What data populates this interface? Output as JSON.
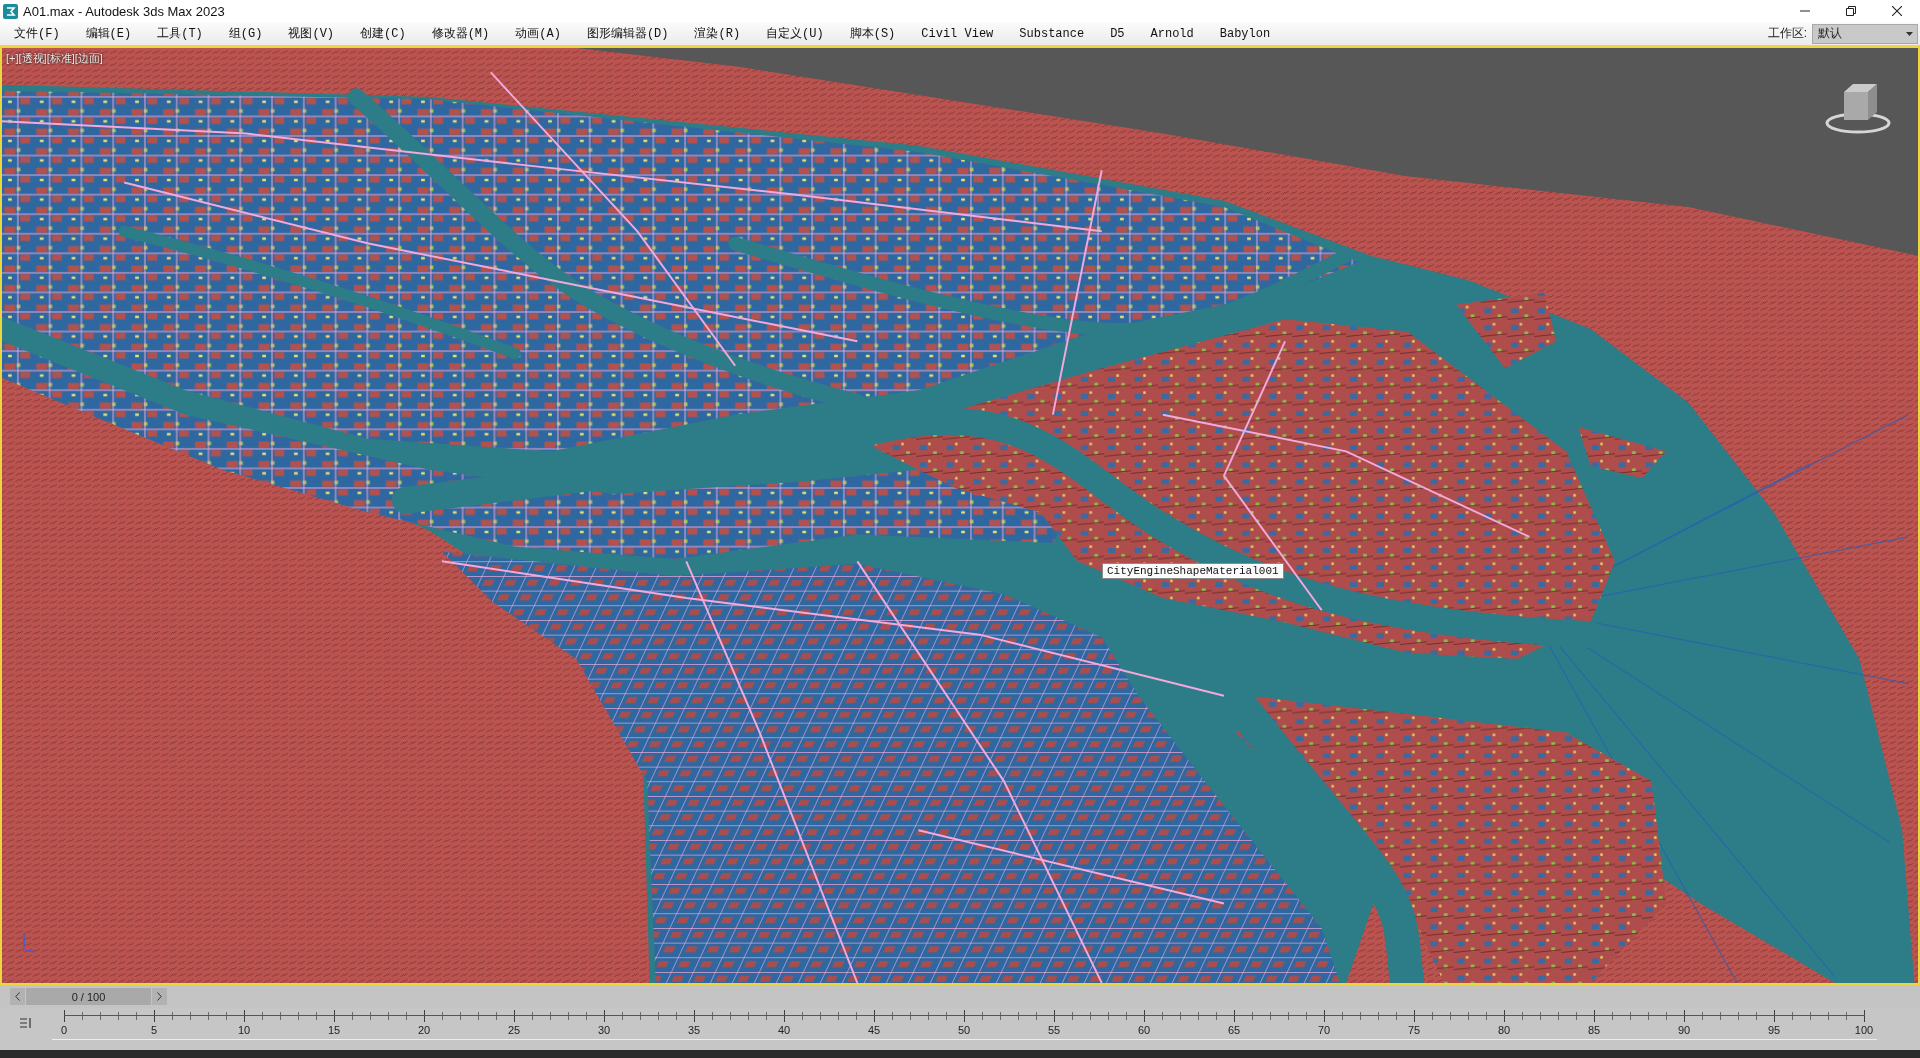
{
  "window": {
    "title": "A01.max - Autodesk 3ds Max 2023"
  },
  "menu_bar": {
    "items": [
      "文件(F)",
      "编辑(E)",
      "工具(T)",
      "组(G)",
      "视图(V)",
      "创建(C)",
      "修改器(M)",
      "动画(A)",
      "图形编辑器(D)",
      "渲染(R)",
      "自定义(U)",
      "脚本(S)",
      "Civil View",
      "Substance",
      "D5",
      "Arnold",
      "Babylon"
    ],
    "workspace": {
      "label": "工作区:",
      "value": "默认"
    }
  },
  "viewport": {
    "label": "[+][透视][标准][边面]",
    "active": true,
    "tooltip": "CityEngineShapeMaterial001"
  },
  "time_slider": {
    "position": "0 / 100",
    "level": 0
  },
  "track_bar": {
    "labels": [
      "0",
      "5",
      "10",
      "15",
      "20",
      "25",
      "30",
      "35",
      "40",
      "45",
      "50",
      "55",
      "60",
      "65",
      "70",
      "75",
      "80",
      "85",
      "90",
      "95",
      "100"
    ]
  }
}
